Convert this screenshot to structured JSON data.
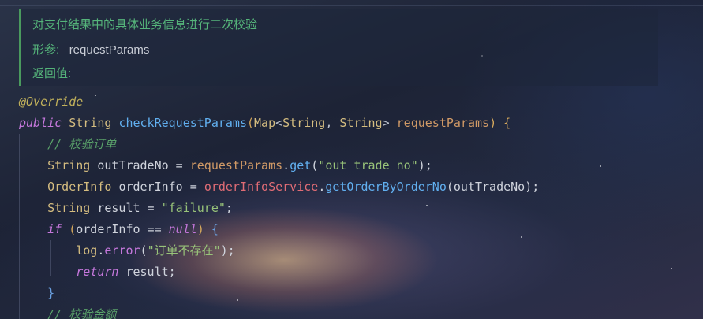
{
  "doc_comment": {
    "summary": "对支付结果中的具体业务信息进行二次校验",
    "param_label": "形参:",
    "param_value": "requestParams",
    "return_label": "返回值:"
  },
  "code": {
    "l1": {
      "annotation": "@Override"
    },
    "l2": {
      "modifier": "public",
      "ret_type": "String",
      "method": "checkRequestParams",
      "open_paren": "(",
      "param_type_a": "Map",
      "lt": "<",
      "param_type_b": "String",
      "comma": ", ",
      "param_type_c": "String",
      "gt": ">",
      "param_name": "requestParams",
      "close_paren": ")",
      "brace": "{"
    },
    "l3": {
      "comment": "// 校验订单"
    },
    "l4": {
      "type": "String",
      "var": "outTradeNo",
      "eq": " = ",
      "obj": "requestParams",
      "dot": ".",
      "call": "get",
      "lp": "(",
      "str": "\"out_trade_no\"",
      "rp": ");"
    },
    "l5": {
      "type": "OrderInfo",
      "var": "orderInfo",
      "eq": " = ",
      "obj": "orderInfoService",
      "dot": ".",
      "call": "getOrderByOrderNo",
      "lp": "(",
      "arg": "outTradeNo",
      "rp": ");"
    },
    "l6": {
      "type": "String",
      "var": "result",
      "eq": " = ",
      "str": "\"failure\"",
      "semi": ";"
    },
    "l7": {
      "kw": "if",
      "lp": "(",
      "cond": "orderInfo == ",
      "null": "null",
      "rp": ")",
      "brace": "{"
    },
    "l8": {
      "obj": "log",
      "dot": ".",
      "call": "error",
      "lp": "(",
      "str": "\"订单不存在\"",
      "rp": ");"
    },
    "l9": {
      "kw": "return",
      "rest": " result;"
    },
    "l10": {
      "brace": "}"
    },
    "l11": {
      "comment": "// 校验金额"
    }
  }
}
